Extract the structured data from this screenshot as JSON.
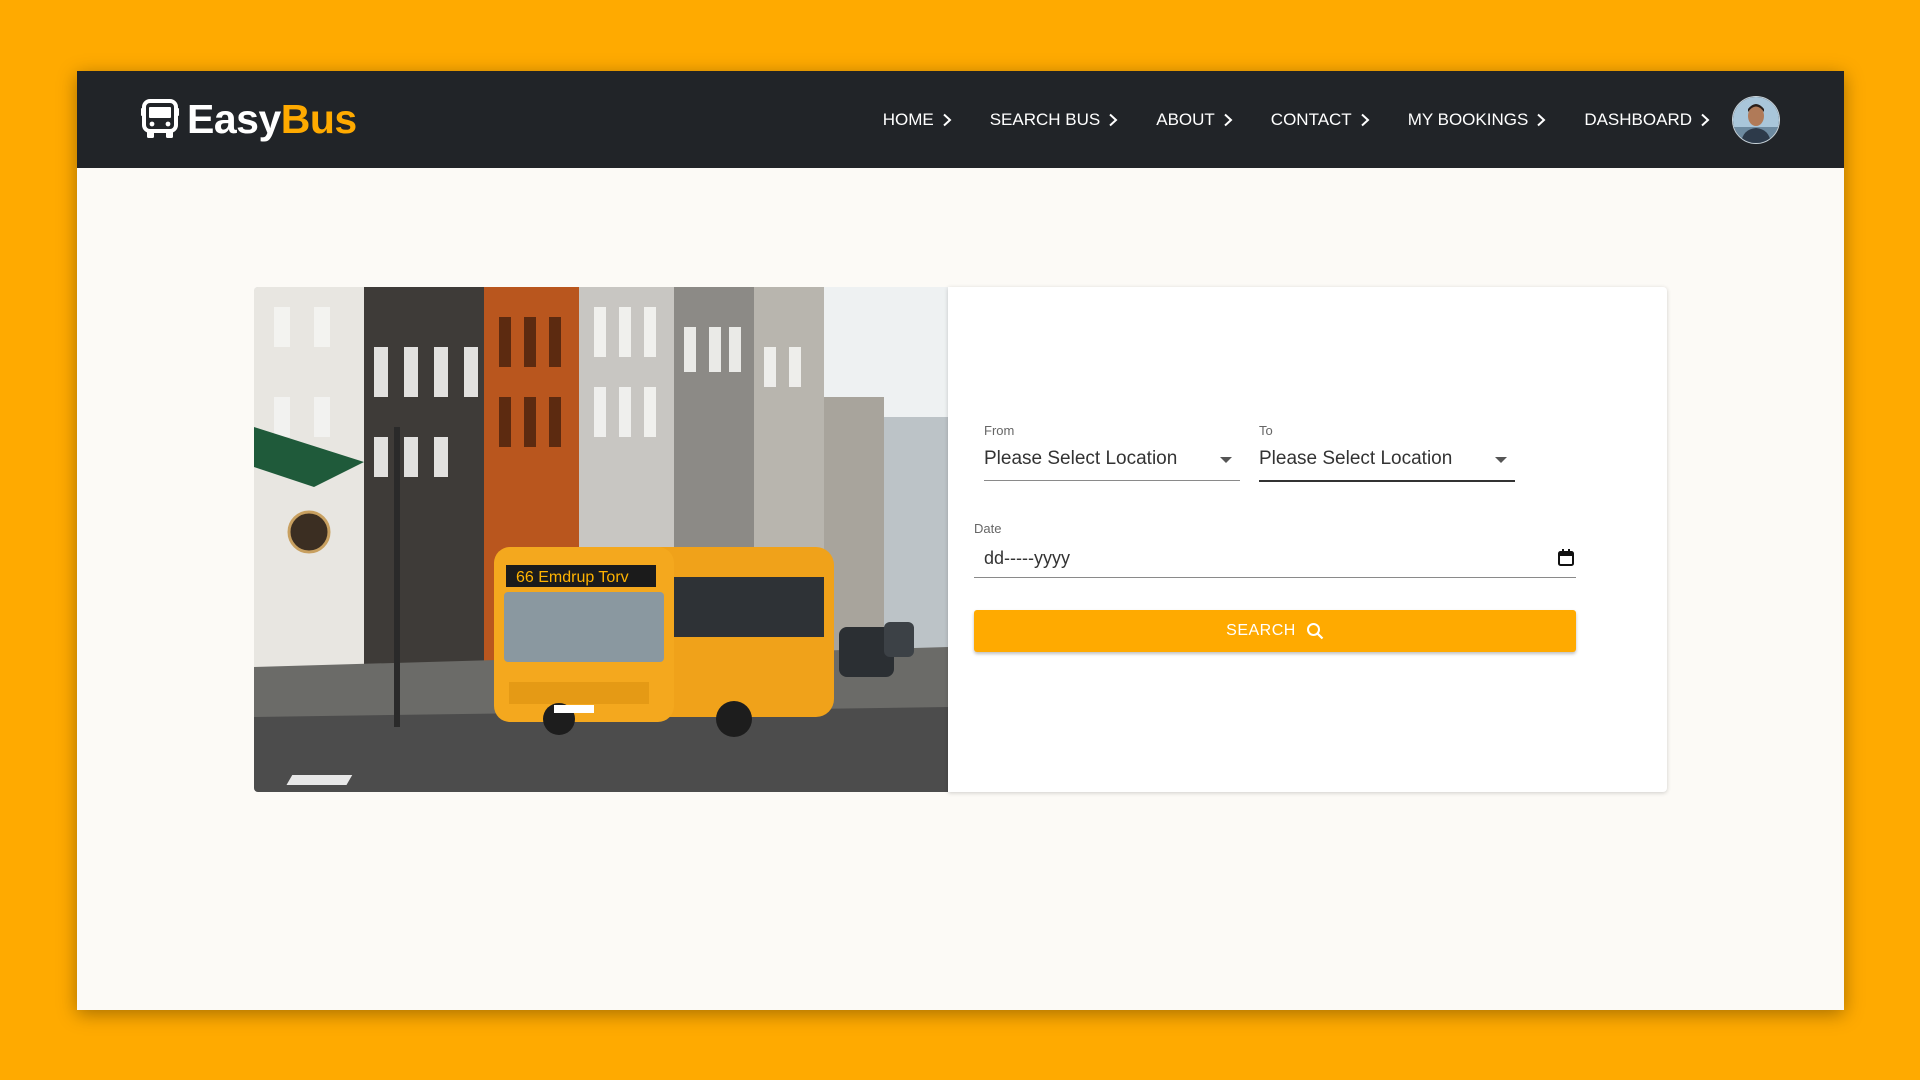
{
  "brand": {
    "part1": "Easy",
    "part2": "Bus",
    "icon": "bus-icon"
  },
  "nav": {
    "items": [
      {
        "label": "HOME"
      },
      {
        "label": "SEARCH BUS"
      },
      {
        "label": "ABOUT"
      },
      {
        "label": "CONTACT"
      },
      {
        "label": "MY BOOKINGS"
      },
      {
        "label": "DASHBOARD"
      }
    ],
    "avatar_icon": "user-avatar"
  },
  "hero": {
    "image_icon": "bus-street-photo"
  },
  "form": {
    "from": {
      "label": "From",
      "value": "Please Select Location"
    },
    "to": {
      "label": "To",
      "value": "Please Select Location"
    },
    "date": {
      "label": "Date",
      "value": "dd-----yyyy"
    },
    "search_label": "SEARCH"
  },
  "colors": {
    "accent": "#FFAA00",
    "navbar": "#212428",
    "page_bg": "#FCFAF6"
  }
}
